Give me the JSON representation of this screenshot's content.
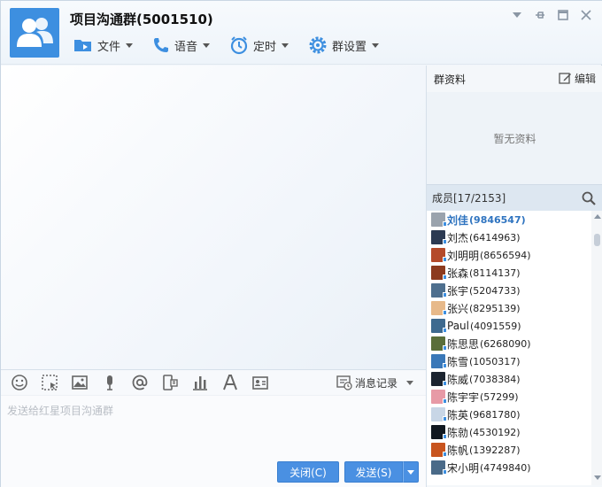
{
  "window": {
    "title": "项目沟通群(5001510)"
  },
  "toolbar": {
    "file": "文件",
    "voice": "语音",
    "timer": "定时",
    "group_settings": "群设置"
  },
  "input": {
    "placeholder": "发送给红星项目沟通群",
    "history_label": "消息记录",
    "close_button": "关闭(C)",
    "send_button": "发送(S)"
  },
  "group_info": {
    "title": "群资料",
    "edit_label": "编辑",
    "empty_text": "暂无资料"
  },
  "members": {
    "header": "成员[17/2153]",
    "list": [
      {
        "name": "刘佳",
        "id": "(9846547)",
        "self": true,
        "color": "#9aa3ad"
      },
      {
        "name": "刘杰",
        "id": "(6414963)",
        "color": "#2c3a52"
      },
      {
        "name": "刘明明",
        "id": "(8656594)",
        "color": "#b44a2a"
      },
      {
        "name": "张森",
        "id": "(8114137)",
        "color": "#8c3a1e"
      },
      {
        "name": "张宇",
        "id": "(5204733)",
        "color": "#4e6f8e"
      },
      {
        "name": "张兴",
        "id": "(8295139)",
        "color": "#e7b98a"
      },
      {
        "name": "Paul",
        "id": "(4091559)",
        "color": "#3e6a8f"
      },
      {
        "name": "陈思思",
        "id": "(6268090)",
        "color": "#5a6e3a"
      },
      {
        "name": "陈雪",
        "id": "(1050317)",
        "color": "#3a78b8"
      },
      {
        "name": "陈威",
        "id": "(7038384)",
        "color": "#1c2430"
      },
      {
        "name": "陈宇宇",
        "id": "(57299)",
        "color": "#e79aa6"
      },
      {
        "name": "陈英",
        "id": "(9681780)",
        "color": "#c8d6e6"
      },
      {
        "name": "陈勍",
        "id": "(4530192)",
        "color": "#111820"
      },
      {
        "name": "陈帆",
        "id": "(1392287)",
        "color": "#c8541e"
      },
      {
        "name": "宋小明",
        "id": "(4749840)",
        "color": "#4a6a88"
      }
    ]
  },
  "colors": {
    "accent": "#4a90e2",
    "avatar_bg": "#3d8fe0",
    "self_member": "#2f74c0"
  },
  "icons": {
    "group_avatar": "group-avatar-icon",
    "file": "folder-icon",
    "voice": "phone-icon",
    "timer": "alarm-clock-icon",
    "settings": "gear-icon",
    "window_menu": "chevron-down-icon",
    "pin": "pin-icon",
    "maximize": "maximize-icon",
    "close": "close-icon",
    "emoji": "smiley-icon",
    "screenshot": "screenshot-icon",
    "image": "image-icon",
    "microphone": "microphone-icon",
    "mention": "at-icon",
    "phone_screen": "phone-screen-icon",
    "poll": "bar-chart-icon",
    "font": "font-icon",
    "card": "card-icon",
    "history": "history-icon",
    "edit": "edit-icon",
    "search": "search-icon"
  }
}
